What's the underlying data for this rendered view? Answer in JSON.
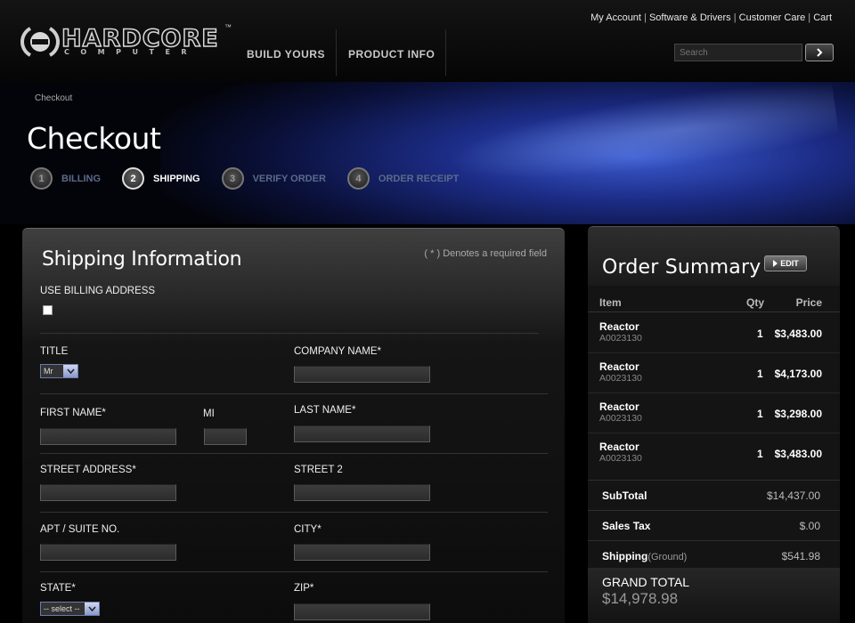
{
  "header": {
    "logo_text": "HARDCORE",
    "logo_sub": "COMPUTER",
    "logo_tm": "™",
    "nav": [
      "BUILD YOURS",
      "PRODUCT INFO"
    ],
    "utility_links": [
      "My Account",
      "Software & Drivers",
      "Customer Care",
      "Cart"
    ],
    "utility_sep": "|",
    "search_placeholder": "Search"
  },
  "hero": {
    "breadcrumb": "Checkout",
    "title": "Checkout",
    "steps": [
      {
        "num": "1",
        "label": "BILLING",
        "active": false
      },
      {
        "num": "2",
        "label": "SHIPPING",
        "active": true
      },
      {
        "num": "3",
        "label": "VERIFY ORDER",
        "active": false
      },
      {
        "num": "4",
        "label": "ORDER RECEIPT",
        "active": false
      }
    ]
  },
  "shipping": {
    "title": "Shipping Information",
    "required_note": "( * ) Denotes a required field",
    "use_billing_label": "USE BILLING ADDRESS",
    "use_billing_checked": false,
    "fields": {
      "title": {
        "label": "TITLE",
        "value": "Mr"
      },
      "company": {
        "label": "COMPANY NAME*"
      },
      "first_name": {
        "label": "FIRST NAME*"
      },
      "mi": {
        "label": "MI"
      },
      "last_name": {
        "label": "LAST NAME*"
      },
      "street": {
        "label": "STREET ADDRESS*"
      },
      "street2": {
        "label": "STREET 2"
      },
      "apt": {
        "label": "APT / SUITE NO."
      },
      "city": {
        "label": "CITY*"
      },
      "state": {
        "label": "STATE*",
        "value": "-- select --"
      },
      "zip": {
        "label": "ZIP*"
      }
    }
  },
  "summary": {
    "title": "Order Summary",
    "edit_label": "EDIT",
    "columns": {
      "item": "Item",
      "qty": "Qty",
      "price": "Price"
    },
    "items": [
      {
        "name": "Reactor",
        "code": "A0023130",
        "qty": "1",
        "price": "$3,483.00"
      },
      {
        "name": "Reactor",
        "code": "A0023130",
        "qty": "1",
        "price": "$4,173.00"
      },
      {
        "name": "Reactor",
        "code": "A0023130",
        "qty": "1",
        "price": "$3,298.00"
      },
      {
        "name": "Reactor",
        "code": "A0023130",
        "qty": "1",
        "price": "$3,483.00"
      }
    ],
    "subtotal": {
      "label": "SubTotal",
      "value": "$14,437.00"
    },
    "tax": {
      "label": "Sales Tax",
      "value": "$.00"
    },
    "shipping": {
      "label": "Shipping",
      "method": "(Ground)",
      "value": "$541.98"
    },
    "grand_total": {
      "label": "GRAND TOTAL",
      "value": "$14,978.98"
    }
  },
  "colors": {
    "accent_blue": "#3b5bd0",
    "background": "#000000",
    "select_arrow": "#8898c8"
  }
}
